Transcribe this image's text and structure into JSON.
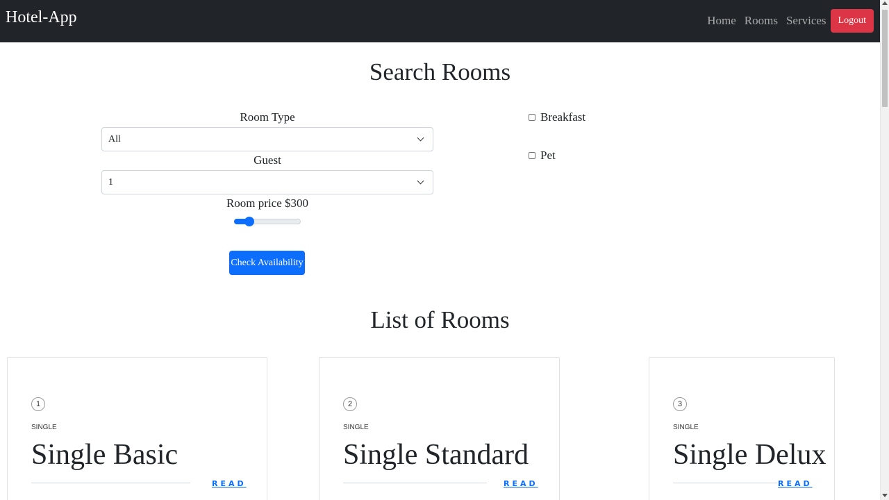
{
  "navbar": {
    "brand": "Hotel-App",
    "links": [
      "Home",
      "Rooms",
      "Services"
    ],
    "logout_label": "Logout"
  },
  "search": {
    "title": "Search Rooms",
    "room_type_label": "Room Type",
    "room_type_value": "All",
    "guest_label": "Guest",
    "guest_value": "1",
    "price_label": "Room price $300",
    "price_slider_fraction": 0.18,
    "button_label": "Check Availability",
    "options": [
      {
        "label": "Breakfast",
        "checked": false
      },
      {
        "label": "Pet",
        "checked": false
      }
    ]
  },
  "rooms": {
    "title": "List of Rooms",
    "read_label": "READ",
    "items": [
      {
        "number": "1",
        "type": "SINGLE",
        "name": "Single Basic"
      },
      {
        "number": "2",
        "type": "SINGLE",
        "name": "Single Standard"
      },
      {
        "number": "3",
        "type": "SINGLE",
        "name": "Single Delux"
      }
    ]
  },
  "colors": {
    "navbar_bg": "#212529",
    "primary": "#0d6efd",
    "danger": "#dc3545"
  }
}
